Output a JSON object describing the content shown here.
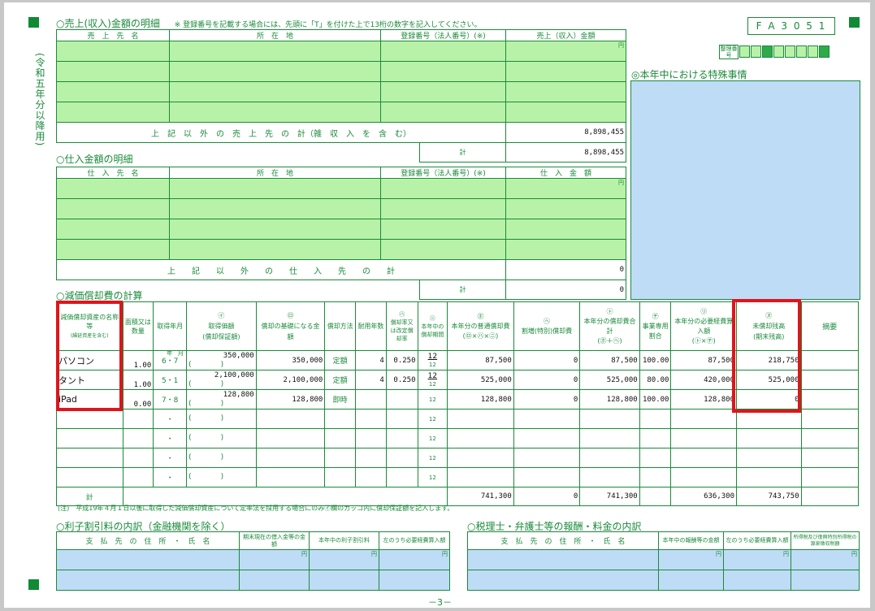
{
  "form_id": "F A 3 0 5 1",
  "side_label": "(令和五年分以降用)",
  "page_number": "－3－",
  "sales": {
    "title": "○売上(収入)金額の明細",
    "note": "※ 登録番号を記載する場合には、先頭に「T」を付けた上で13桁の数字を記入してください。",
    "headers": [
      "売　上　先　名",
      "所　在　地",
      "登録番号（法人番号）(※)",
      "売上（収入）金額"
    ],
    "unit": "円",
    "other_label": "上　記　以　外　の　売　上　先　の　計（雑　収　入　を　含　む）",
    "other_value": "8,898,455",
    "total_label": "計",
    "total_value": "8,898,455"
  },
  "reference": {
    "label": "整理番号"
  },
  "special": {
    "title": "◎本年中における特殊事情"
  },
  "purchase": {
    "title": "○仕入金額の明細",
    "headers": [
      "仕　入　先　名",
      "所　在　地",
      "登録番号（法人番号）(※)",
      "仕　入　金　額"
    ],
    "unit": "円",
    "other_label": "上　　記　　以　　外　　の　　仕　　入　　先　　の　　計",
    "other_value": "0",
    "total_label": "計",
    "total_value": "0"
  },
  "depreciation": {
    "title": "○減価償却費の計算",
    "headers": {
      "name": "減価償却資産の名称等",
      "name_sub": "(繰延資産を含む)",
      "area": "面積又は数量",
      "acq_date": "取得年月",
      "acq_cost": "取得価額",
      "acq_cost_sub": "(償却保証額)",
      "base": "償却の基礎になる金額",
      "method": "償却方法",
      "life": "耐用年数",
      "rate": "償却率又は改定償却率",
      "months": "本年中の償却期間",
      "normal": "本年分の普通償却費",
      "special": "割増(特別)償却費",
      "total": "本年分の償却費合計",
      "business_ratio": "事業専用割合",
      "expense": "本年分の必要経費算入額",
      "remaining": "未償却残高",
      "remaining_sub": "(期末残高)",
      "remarks": "摘要"
    },
    "marks": {
      "i": "㋑",
      "ro": "㋺",
      "ha": "㋩",
      "ni": "㋥",
      "ho": "㋭",
      "he": "㋬",
      "to": "㋣",
      "chi": "㋠",
      "ri": "㋷",
      "nu": "㋦"
    },
    "formula_normal": "(㋺×㋩×㋥)",
    "formula_total": "(㋭＋㋬)",
    "formula_expense": "(㋣×㋠)",
    "units": {
      "year_month": "年　月",
      "yen": "円",
      "year": "年",
      "percent": "%",
      "twelve": "12"
    },
    "rows": [
      {
        "name": "パソコン",
        "qty": "1.00",
        "date": "6・7",
        "cost": "350,000",
        "guarantee": "(　　　　)",
        "base": "350,000",
        "method": "定額",
        "life": "4",
        "rate": "0.250",
        "months": "12",
        "normal": "87,500",
        "special": "0",
        "total": "87,500",
        "ratio": "100.00",
        "expense": "87,500",
        "remaining": "218,750"
      },
      {
        "name": "タント",
        "qty": "1.00",
        "date": "5・1",
        "cost": "2,100,000",
        "guarantee": "(　　　　)",
        "base": "2,100,000",
        "method": "定額",
        "life": "4",
        "rate": "0.250",
        "months": "12",
        "normal": "525,000",
        "special": "0",
        "total": "525,000",
        "ratio": "80.00",
        "expense": "420,000",
        "remaining": "525,000"
      },
      {
        "name": "iPad",
        "qty": "0.00",
        "date": "7・8",
        "cost": "128,800",
        "guarantee": "(　　　　)",
        "base": "128,800",
        "method": "即時",
        "life": "",
        "rate": "",
        "months": "",
        "normal": "128,800",
        "special": "0",
        "total": "128,800",
        "ratio": "100.00",
        "expense": "128,800",
        "remaining": "0"
      },
      {
        "name": "",
        "qty": "",
        "date": "・",
        "cost": "",
        "guarantee": "(　　　　)",
        "base": "",
        "method": "",
        "life": "",
        "rate": "",
        "months": "",
        "normal": "",
        "special": "",
        "total": "",
        "ratio": "",
        "expense": "",
        "remaining": ""
      },
      {
        "name": "",
        "qty": "",
        "date": "・",
        "cost": "",
        "guarantee": "(　　　　)",
        "base": "",
        "method": "",
        "life": "",
        "rate": "",
        "months": "",
        "normal": "",
        "special": "",
        "total": "",
        "ratio": "",
        "expense": "",
        "remaining": ""
      },
      {
        "name": "",
        "qty": "",
        "date": "・",
        "cost": "",
        "guarantee": "(　　　　)",
        "base": "",
        "method": "",
        "life": "",
        "rate": "",
        "months": "",
        "normal": "",
        "special": "",
        "total": "",
        "ratio": "",
        "expense": "",
        "remaining": ""
      },
      {
        "name": "",
        "qty": "",
        "date": "・",
        "cost": "",
        "guarantee": "(　　　　)",
        "base": "",
        "method": "",
        "life": "",
        "rate": "",
        "months": "",
        "normal": "",
        "special": "",
        "total": "",
        "ratio": "",
        "expense": "",
        "remaining": ""
      }
    ],
    "total_label": "計",
    "total_normal": "741,300",
    "total_special": "0",
    "total_total": "741,300",
    "total_expense": "636,300",
    "total_remaining": "743,750",
    "note": "(注)　平成19年４月１日以後に取得した減価償却資産について定率法を採用する場合にのみ㋑欄のカッコ内に償却保証額を記入します。"
  },
  "interest": {
    "title": "○利子割引料の内訳（金融機関を除く）",
    "headers": [
      "支　払　先　の　住　所　・　氏　名",
      "期末現在の借入金等の金額",
      "本年中の利子割引料",
      "左のうち必要経費算入額"
    ],
    "unit": "円"
  },
  "tax_accountant": {
    "title": "○税理士・弁護士等の報酬・料金の内訳",
    "headers": [
      "支　払　先　の　住　所　・　氏　名",
      "本年中の報酬等の金額",
      "左のうち必要経費算入額",
      "所得税及び復興特別所得税の源泉徴収税額"
    ],
    "unit": "円"
  }
}
